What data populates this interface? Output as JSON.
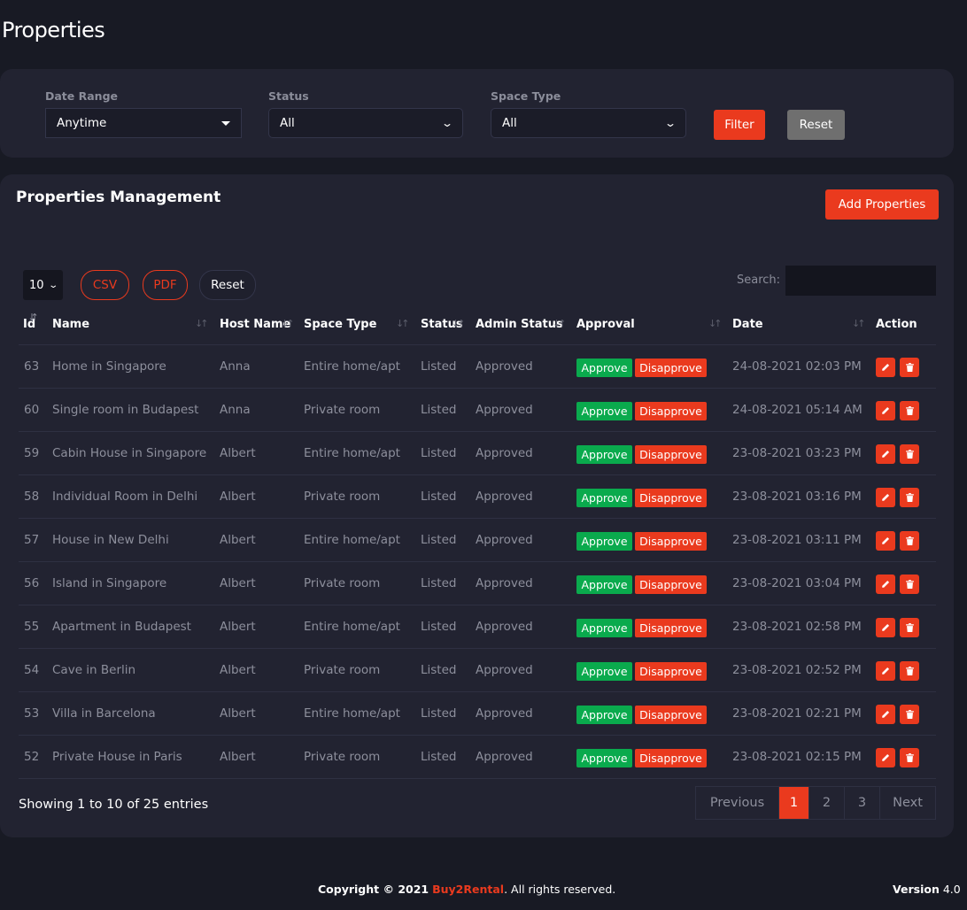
{
  "page": {
    "title": "Properties"
  },
  "filters": {
    "date_range": {
      "label": "Date Range",
      "value": "Anytime"
    },
    "status": {
      "label": "Status",
      "value": "All"
    },
    "space_type": {
      "label": "Space Type",
      "value": "All"
    },
    "filter_button": "Filter",
    "reset_button": "Reset"
  },
  "management": {
    "title": "Properties Management",
    "add_button": "Add Properties",
    "page_length": "10",
    "export_csv": "CSV",
    "export_pdf": "PDF",
    "reset_button": "Reset",
    "search_label": "Search:",
    "search_value": ""
  },
  "table": {
    "columns": [
      "Id",
      "Name",
      "Host Name",
      "Space Type",
      "Status",
      "Admin Status",
      "Approval",
      "Date",
      "Action"
    ],
    "approve_label": "Approve",
    "disapprove_label": "Disapprove",
    "rows": [
      {
        "id": "63",
        "name": "Home in Singapore",
        "host": "Anna",
        "space_type": "Entire home/apt",
        "status": "Listed",
        "admin_status": "Approved",
        "date": "24-08-2021 02:03 PM"
      },
      {
        "id": "60",
        "name": "Single room in Budapest",
        "host": "Anna",
        "space_type": "Private room",
        "status": "Listed",
        "admin_status": "Approved",
        "date": "24-08-2021 05:14 AM"
      },
      {
        "id": "59",
        "name": "Cabin House in Singapore",
        "host": "Albert",
        "space_type": "Entire home/apt",
        "status": "Listed",
        "admin_status": "Approved",
        "date": "23-08-2021 03:23 PM"
      },
      {
        "id": "58",
        "name": "Individual Room in Delhi",
        "host": "Albert",
        "space_type": "Private room",
        "status": "Listed",
        "admin_status": "Approved",
        "date": "23-08-2021 03:16 PM"
      },
      {
        "id": "57",
        "name": "House in New Delhi",
        "host": "Albert",
        "space_type": "Entire home/apt",
        "status": "Listed",
        "admin_status": "Approved",
        "date": "23-08-2021 03:11 PM"
      },
      {
        "id": "56",
        "name": "Island in Singapore",
        "host": "Albert",
        "space_type": "Private room",
        "status": "Listed",
        "admin_status": "Approved",
        "date": "23-08-2021 03:04 PM"
      },
      {
        "id": "55",
        "name": "Apartment in Budapest",
        "host": "Albert",
        "space_type": "Entire home/apt",
        "status": "Listed",
        "admin_status": "Approved",
        "date": "23-08-2021 02:58 PM"
      },
      {
        "id": "54",
        "name": "Cave in Berlin",
        "host": "Albert",
        "space_type": "Private room",
        "status": "Listed",
        "admin_status": "Approved",
        "date": "23-08-2021 02:52 PM"
      },
      {
        "id": "53",
        "name": "Villa in Barcelona",
        "host": "Albert",
        "space_type": "Entire home/apt",
        "status": "Listed",
        "admin_status": "Approved",
        "date": "23-08-2021 02:21 PM"
      },
      {
        "id": "52",
        "name": "Private House in Paris",
        "host": "Albert",
        "space_type": "Private room",
        "status": "Listed",
        "admin_status": "Approved",
        "date": "23-08-2021 02:15 PM"
      }
    ]
  },
  "pagination": {
    "info": "Showing 1 to 10 of 25 entries",
    "previous": "Previous",
    "pages": [
      "1",
      "2",
      "3"
    ],
    "active_page": "1",
    "next": "Next"
  },
  "footer": {
    "copyright_prefix": "Copyright © 2021",
    "brand": "Buy2Rental",
    "copyright_suffix": ". All rights reserved.",
    "version_label": "Version",
    "version_number": "4.0"
  },
  "colors": {
    "background": "#181a24",
    "card": "#222331",
    "accent": "#ea3a1e",
    "approve": "#0aaa4d",
    "muted_text": "#8d8f9c"
  }
}
